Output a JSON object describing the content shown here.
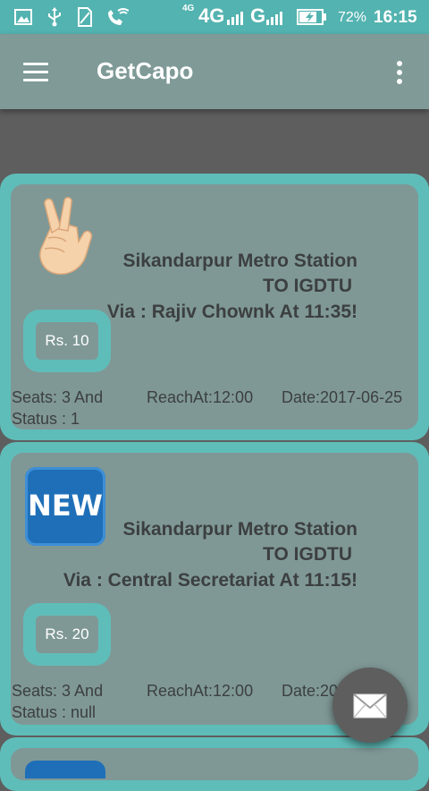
{
  "status_bar": {
    "network_4g_small": "4G",
    "network_4g": "4G",
    "network_g": "G",
    "battery_percent": "72%",
    "time": "16:15"
  },
  "app_bar": {
    "title": "GetCapo"
  },
  "rides": [
    {
      "icon": "crossed-fingers-emoji",
      "from": "Sikandarpur Metro Station",
      "to": "TO IGDTU",
      "via": "Via : Rajiv Chownk At 11:35!",
      "price": "Rs. 10",
      "seats": "Seats: 3 And",
      "status": "Status : 1",
      "reach_at": "ReachAt:12:00",
      "date": "Date:2017-06-25"
    },
    {
      "icon": "new-button-emoji",
      "from": "Sikandarpur Metro Station",
      "to": "TO IGDTU",
      "via": "Via : Central Secretariat At 11:15!",
      "price": "Rs. 20",
      "seats": "Seats: 3 And",
      "status": "Status : null",
      "reach_at": "ReachAt:12:00",
      "date": "Date:20"
    }
  ],
  "new_badge_text": "NEW",
  "colors": {
    "status_bar": "#53b3b0",
    "app_bar": "#7f9a97",
    "card_border": "#5fbdb9",
    "card_fill": "#7f9896",
    "background": "#5e5e5e"
  }
}
